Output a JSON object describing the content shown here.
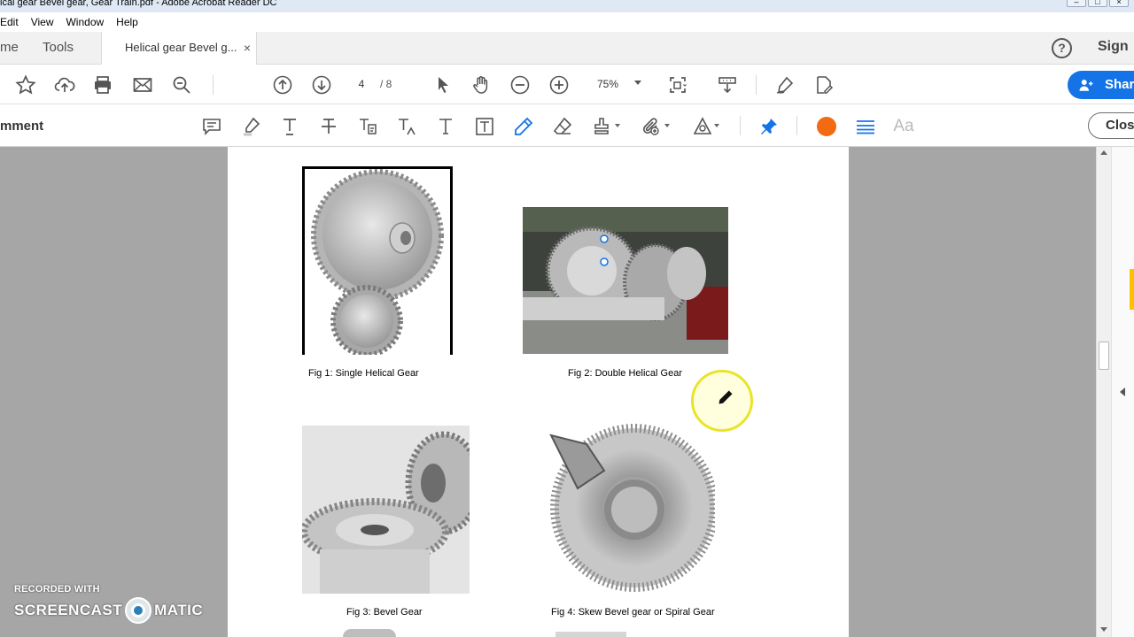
{
  "window": {
    "title": "ical gear Bevel gear, Gear Train.pdf - Adobe Acrobat Reader DC"
  },
  "menu": {
    "items": [
      "Edit",
      "View",
      "Window",
      "Help"
    ]
  },
  "tabs": {
    "home": "me",
    "tools": "Tools",
    "document": "Helical gear Bevel g...",
    "close_glyph": "×",
    "help_glyph": "?",
    "sign_in": "Sign"
  },
  "toolbar": {
    "page_current": "4",
    "page_total": "/ 8",
    "zoom": "75%",
    "share_label": "Shar",
    "icons": [
      "star-icon",
      "upload-icon",
      "print-icon",
      "mail-icon",
      "zoom-search-icon",
      "prev-page-icon",
      "next-page-icon",
      "select-cursor-icon",
      "hand-icon",
      "zoom-out-icon",
      "zoom-in-icon",
      "fit-page-icon",
      "scroll-mode-icon",
      "sign-pen-icon",
      "fill-sign-icon"
    ]
  },
  "comment_bar": {
    "label": "mment",
    "close_label": "Close",
    "text_tool_label": "Aa",
    "accent_color": "#f26a12",
    "icons": [
      "sticky-note-icon",
      "highlighter-icon",
      "text-underline-icon",
      "strikethrough-icon",
      "replace-text-icon",
      "insert-text-icon",
      "add-text-icon",
      "text-box-icon",
      "pencil-icon",
      "eraser-icon",
      "stamp-icon",
      "attach-icon",
      "shapes-icon",
      "pin-icon",
      "line-weight-icon"
    ]
  },
  "document": {
    "figures": [
      {
        "caption": "Fig 1: Single Helical Gear"
      },
      {
        "caption": "Fig 2: Double Helical Gear"
      },
      {
        "caption": "Fig 3: Bevel Gear"
      },
      {
        "caption": "Fig 4: Skew Bevel gear or Spiral Gear"
      }
    ]
  },
  "watermark": {
    "line1": "RECORDED WITH",
    "left": "SCREENCAST",
    "right": "MATIC"
  },
  "colors": {
    "brand_blue": "#1473e6",
    "cursor_ring": "#e9e42a",
    "rail_marker": "#ffc000"
  }
}
